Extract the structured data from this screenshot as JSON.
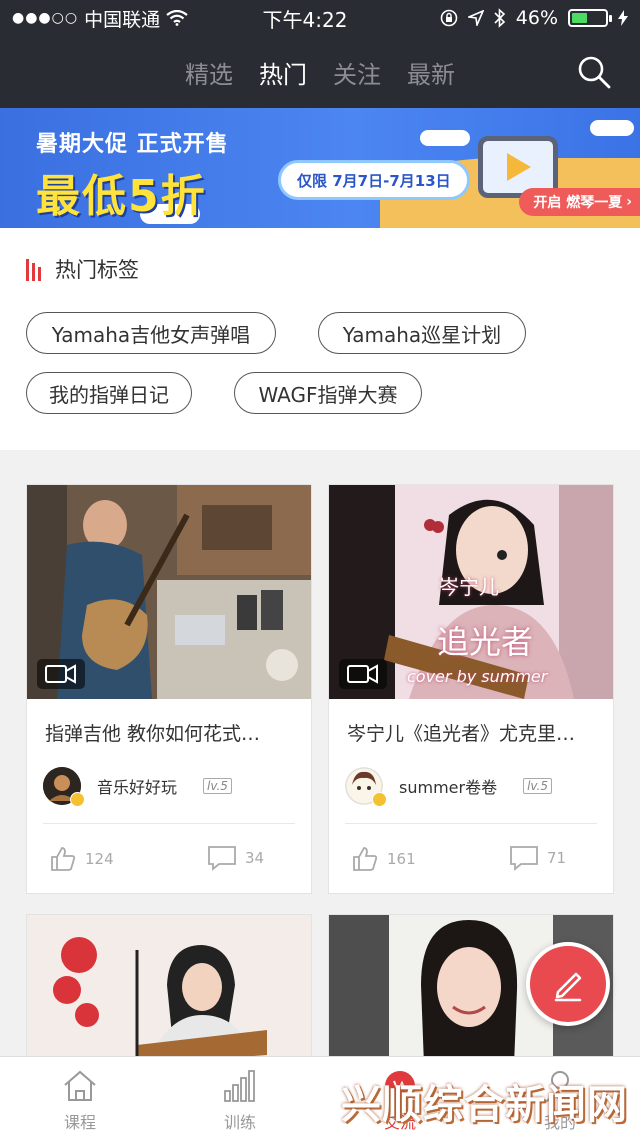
{
  "status_bar": {
    "carrier": "中国联通",
    "time": "下午4:22",
    "battery": "46%",
    "battery_level": 0.46
  },
  "header": {
    "tabs": [
      {
        "label": "精选",
        "active": false
      },
      {
        "label": "热门",
        "active": true
      },
      {
        "label": "关注",
        "active": false
      },
      {
        "label": "最新",
        "active": false
      }
    ],
    "search_icon": "search-icon"
  },
  "banner": {
    "line1": "暑期大促 正式开售",
    "line2": "最低5折",
    "dates": "仅限 7月7日-7月13日",
    "cta": "开启 燃琴一夏"
  },
  "hot_tags": {
    "title": "热门标签",
    "tags": [
      "Yamaha吉他女声弹唱",
      "Yamaha巡星计划",
      "我的指弹日记",
      "WAGF指弹大赛"
    ]
  },
  "cards": [
    {
      "title": "指弹吉他 教你如何花式…",
      "author": "音乐好好玩",
      "level": "lv.5",
      "likes": "124",
      "comments": "34"
    },
    {
      "title": "岑宁儿《追光者》尤克里…",
      "author": "summer卷卷",
      "level": "lv.5",
      "likes": "161",
      "comments": "71",
      "overlay_line1": "岑宁儿",
      "overlay_line2": "追光者",
      "overlay_line3": "cover by summer"
    }
  ],
  "bottom_nav": {
    "items": [
      {
        "label": "课程",
        "icon": "home-icon",
        "active": false
      },
      {
        "label": "训练",
        "icon": "bars-icon",
        "active": false
      },
      {
        "label": "交流",
        "icon": "chat-icon",
        "active": true
      },
      {
        "label": "我的",
        "icon": "person-icon",
        "active": false
      }
    ]
  },
  "watermark": "兴顺综合新闻网",
  "colors": {
    "accent": "#e0393e",
    "header_bg": "#2a2c33",
    "fab": "#e84a4f"
  }
}
